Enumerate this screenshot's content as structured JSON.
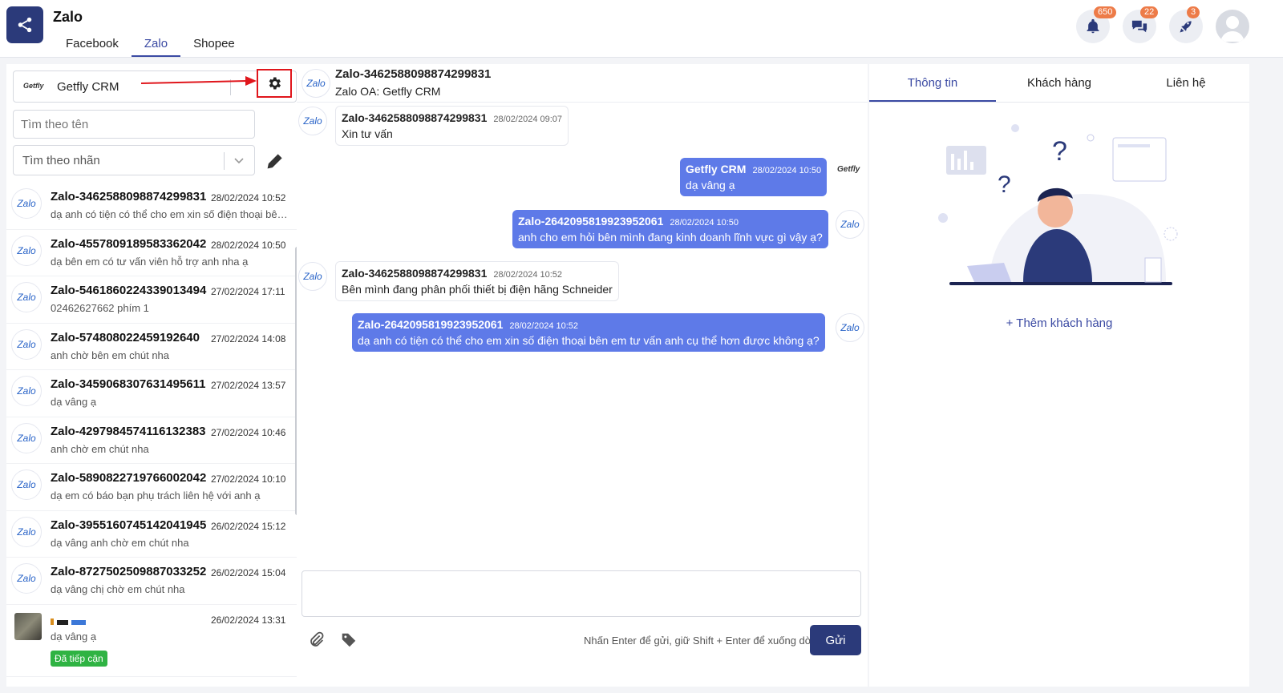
{
  "app": {
    "title": "Zalo",
    "icon": "share-icon"
  },
  "tabs": [
    {
      "label": "Facebook"
    },
    {
      "label": "Zalo"
    },
    {
      "label": "Shopee"
    }
  ],
  "notifications": {
    "bell": "650",
    "chat": "22",
    "rocket": "3"
  },
  "account": {
    "logo": "Getfly",
    "name": "Getfly CRM"
  },
  "search": {
    "placeholder": "Tìm theo tên"
  },
  "tag_filter": {
    "placeholder": "Tìm theo nhãn"
  },
  "conversations": [
    {
      "name": "Zalo-3462588098874299831",
      "time": "28/02/2024 10:52",
      "preview": "dạ anh có tiện có thể cho em xin số điện thoại bên em tư vấn anh cụ thể hơn được không ạ?"
    },
    {
      "name": "Zalo-4557809189583362042",
      "time": "28/02/2024 10:50",
      "preview": "dạ bên em có tư vấn viên hỗ trợ anh nha ạ"
    },
    {
      "name": "Zalo-5461860224339013494",
      "time": "27/02/2024 17:11",
      "preview": "02462627662 phím 1"
    },
    {
      "name": "Zalo-574808022459192640",
      "time": "27/02/2024 14:08",
      "preview": "anh chờ bên em chút nha"
    },
    {
      "name": "Zalo-3459068307631495611",
      "time": "27/02/2024 13:57",
      "preview": "dạ vâng ạ"
    },
    {
      "name": "Zalo-4297984574116132383",
      "time": "27/02/2024 10:46",
      "preview": "anh chờ em chút nha"
    },
    {
      "name": "Zalo-5890822719766002042",
      "time": "27/02/2024 10:10",
      "preview": "dạ em có báo bạn phụ trách liên hệ với anh ạ"
    },
    {
      "name": "Zalo-3955160745142041945",
      "time": "26/02/2024 15:12",
      "preview": "dạ vâng anh chờ em chút nha"
    },
    {
      "name": "Zalo-8727502509887033252",
      "time": "26/02/2024 15:04",
      "preview": "dạ vâng chị chờ em chút nha"
    },
    {
      "name": "",
      "time": "26/02/2024 13:31",
      "preview": "dạ vâng ạ",
      "tag": "Đã tiếp cận"
    }
  ],
  "chat": {
    "title": "Zalo-3462588098874299831",
    "subtitle": "Zalo OA: Getfly CRM",
    "avatar_text": "Zalo",
    "messages": [
      {
        "sender": "Zalo-3462588098874299831",
        "time": "28/02/2024 09:07",
        "text": "Xin tư vấn",
        "dir": "in"
      },
      {
        "sender": "Getfly CRM",
        "time": "28/02/2024 10:50",
        "text": "dạ vâng ạ",
        "dir": "out",
        "avatar": "Getfly"
      },
      {
        "sender": "Zalo-2642095819923952061",
        "time": "28/02/2024 10:50",
        "text": "anh cho em hỏi bên mình đang kinh doanh lĩnh vực gì vậy ạ?",
        "dir": "out",
        "avatar": "Zalo"
      },
      {
        "sender": "Zalo-3462588098874299831",
        "time": "28/02/2024 10:52",
        "text": "Bên mình đang phân phối thiết bị điện hãng Schneider",
        "dir": "in"
      },
      {
        "sender": "Zalo-2642095819923952061",
        "time": "28/02/2024 10:52",
        "text": "dạ anh có tiện có thể cho em xin số điện thoại bên em tư vấn anh cụ thể hơn được không ạ?",
        "dir": "out",
        "avatar": "Zalo"
      }
    ],
    "hint": "Nhấn Enter để gửi, giữ Shift + Enter để xuống dòng",
    "send_label": "Gửi"
  },
  "right": {
    "tabs": [
      {
        "label": "Thông tin"
      },
      {
        "label": "Khách hàng"
      },
      {
        "label": "Liên hệ"
      }
    ],
    "add_customer": "+ Thêm khách hàng"
  },
  "colors": {
    "primary": "#2b3a7a",
    "accent": "#3b4aa3",
    "bubble_out": "#5e7ae8",
    "badge": "#ed7b48",
    "highlight": "#e0161c"
  }
}
